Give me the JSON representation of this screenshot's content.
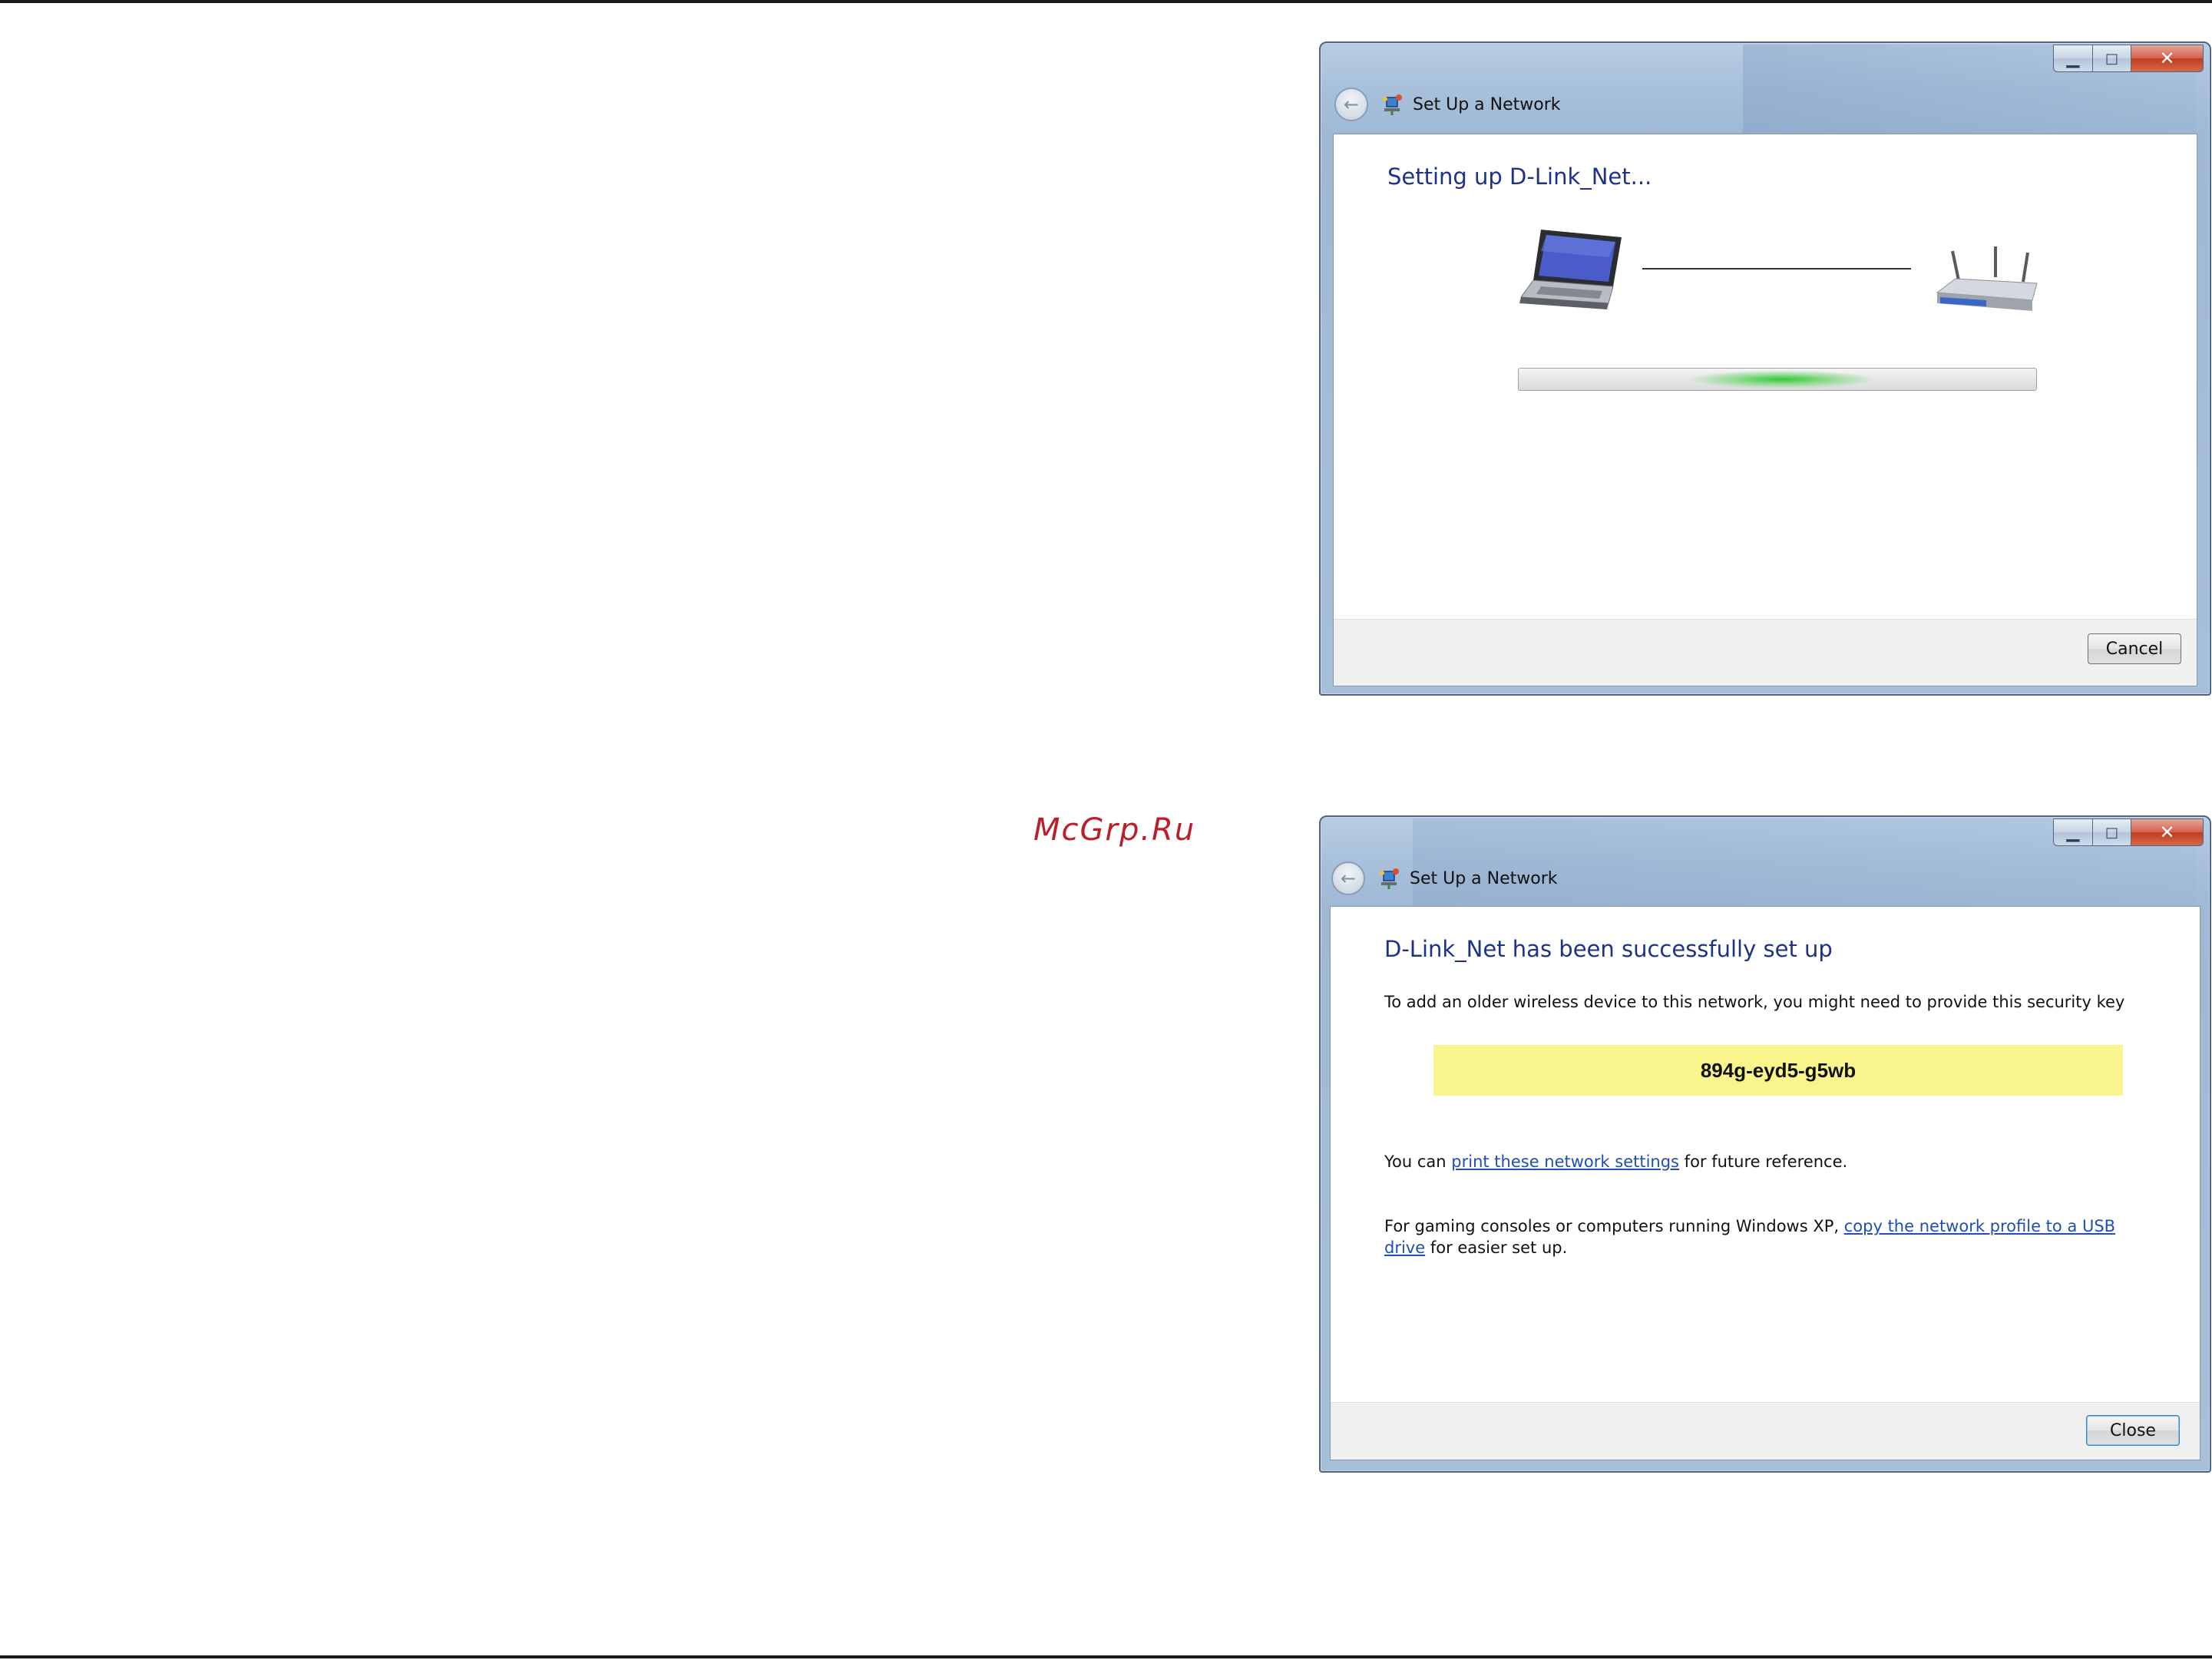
{
  "watermark": "McGrp.Ru",
  "dialogs": [
    {
      "title": "Set Up a Network",
      "heading": "Setting up D-Link_Net...",
      "progress": 0.42,
      "button": "Cancel"
    },
    {
      "title": "Set Up a Network",
      "heading": "D-Link_Net has been successfully set up",
      "instruction": "To add an older wireless device to this network, you might need to provide this security key",
      "security_key": "894g-eyd5-g5wb",
      "print_prefix": "You can ",
      "print_link": "print these network settings",
      "print_suffix": " for future reference.",
      "usb_prefix": "For gaming consoles or computers running Windows XP, ",
      "usb_link": "copy the network profile to a USB drive",
      "usb_suffix": " for easier set up.",
      "button": "Close"
    }
  ]
}
